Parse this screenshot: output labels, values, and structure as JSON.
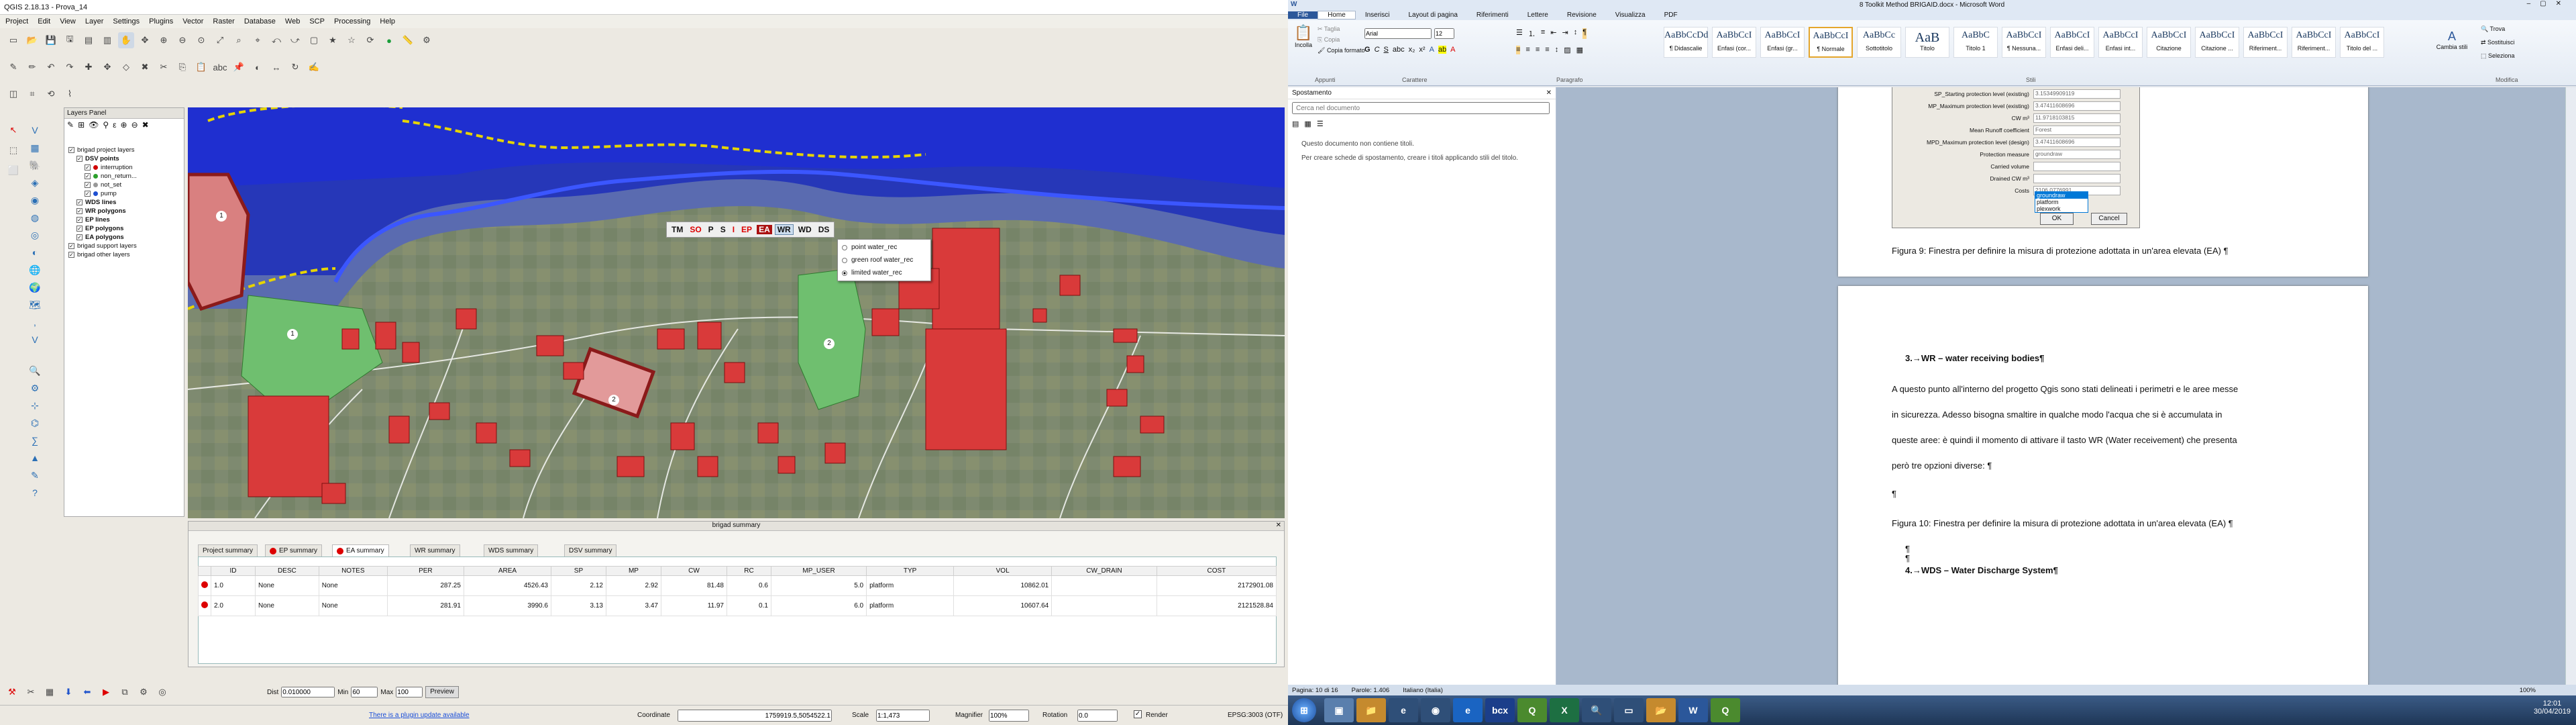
{
  "qgis": {
    "title": "QGIS 2.18.13 - Prova_14",
    "menu": [
      "Project",
      "Edit",
      "View",
      "Layer",
      "Settings",
      "Plugins",
      "Vector",
      "Raster",
      "Database",
      "Web",
      "SCP",
      "Processing",
      "Help"
    ],
    "layers_panel_title": "Layers Panel",
    "layers": [
      {
        "label": "brigad project layers",
        "indent": 0
      },
      {
        "label": "DSV points",
        "indent": 1,
        "bold": true
      },
      {
        "label": "interruption",
        "indent": 2,
        "color": "#d00000"
      },
      {
        "label": "non_return...",
        "indent": 2,
        "color": "#2ca02c"
      },
      {
        "label": "not_set",
        "indent": 2,
        "color": "#999999"
      },
      {
        "label": "pump",
        "indent": 2,
        "color": "#1f4fd1"
      },
      {
        "label": "WDS lines",
        "indent": 1,
        "bold": true
      },
      {
        "label": "WR polygons",
        "indent": 1,
        "bold": true
      },
      {
        "label": "EP lines",
        "indent": 1,
        "bold": true
      },
      {
        "label": "EP polygons",
        "indent": 1,
        "bold": true
      },
      {
        "label": "EA polygons",
        "indent": 1,
        "bold": true
      },
      {
        "label": "brigad support layers",
        "indent": 0
      },
      {
        "label": "brigad other layers",
        "indent": 0
      }
    ],
    "map_toolbar": [
      "TM",
      "SO",
      "P",
      "S",
      "I",
      "EP",
      "EA",
      "WR",
      "WD",
      "DS"
    ],
    "wr_menu": [
      "point water_rec",
      "green roof water_rec",
      "limited water_rec"
    ],
    "map_labels": [
      "1",
      "1",
      "2",
      "2"
    ],
    "bigado": {
      "title": "brigad summary",
      "tabs": [
        "Project summary",
        "EP summary",
        "EA summary",
        "WR summary",
        "WDS summary",
        "DSV summary"
      ],
      "columns": [
        "ID",
        "DESC",
        "NOTES",
        "PER",
        "AREA",
        "SP",
        "MP",
        "CW",
        "RC",
        "MP_USER",
        "TYP",
        "VOL",
        "CW_DRAIN",
        "COST"
      ],
      "rows": [
        [
          "1.0",
          "None",
          "None",
          "287.25",
          "4526.43",
          "2.12",
          "2.92",
          "81.48",
          "0.6",
          "5.0",
          "platform",
          "10862.01",
          "",
          "2172901.08"
        ],
        [
          "2.0",
          "None",
          "None",
          "281.91",
          "3990.6",
          "3.13",
          "3.47",
          "11.97",
          "0.1",
          "6.0",
          "platform",
          "10607.64",
          "",
          "2121528.84"
        ]
      ]
    },
    "status": {
      "update": "There is a plugin update available",
      "coord_label": "Coordinate",
      "coord": "1759919.5,5054522.1",
      "scale_label": "Scale",
      "scale": "1:1,473",
      "magnifier_label": "Magnifier",
      "magnifier": "100%",
      "rotation_label": "Rotation",
      "rotation": "0.0",
      "render": "Render",
      "crs": "EPSG:3003 (OTF)"
    },
    "toolbar_bottom": {
      "dist_label": "Dist",
      "dist": "0.010000",
      "min_label": "Min",
      "min": "60",
      "max_label": "Max",
      "max": "100",
      "preview": "Preview"
    }
  },
  "word": {
    "title": "8 Toolkit Method BRIGAID.docx - Microsoft Word",
    "tabs": [
      "File",
      "Home",
      "Inserisci",
      "Layout di pagina",
      "Riferimenti",
      "Lettere",
      "Revisione",
      "Visualizza",
      "PDF"
    ],
    "clipboard": {
      "paste": "Incolla",
      "cut": "Taglia",
      "copy": "Copia",
      "format": "Copia formato",
      "group": "Appunti"
    },
    "font": {
      "name": "Arial",
      "size": "12",
      "group": "Carattere"
    },
    "paragraph_group": "Paragrafo",
    "styles_group": "Stili",
    "edit_group": "Modifica",
    "styles": [
      {
        "preview": "AaBbCcDd",
        "label": "¶ Didascalie"
      },
      {
        "preview": "AaBbCcI",
        "label": "Enfasi (cor..."
      },
      {
        "preview": "AaBbCcI",
        "label": "Enfasi (gr..."
      },
      {
        "preview": "AaBbCcI",
        "label": "¶ Normale"
      },
      {
        "preview": "AaBbCc",
        "label": "Sottotitolo"
      },
      {
        "preview": "AaB",
        "label": "Titolo"
      },
      {
        "preview": "AaBbC",
        "label": "Titolo 1"
      },
      {
        "preview": "AaBbCcI",
        "label": "¶ Nessuna..."
      },
      {
        "preview": "AaBbCcI",
        "label": "Enfasi deli..."
      },
      {
        "preview": "AaBbCcI",
        "label": "Enfasi int..."
      },
      {
        "preview": "AaBbCcI",
        "label": "Citazione"
      },
      {
        "preview": "AaBbCcI",
        "label": "Citazione ..."
      },
      {
        "preview": "AaBbCcI",
        "label": "Riferiment..."
      },
      {
        "preview": "AaBbCcI",
        "label": "Riferiment..."
      },
      {
        "preview": "AaBbCcI",
        "label": "Titolo del ..."
      }
    ],
    "change_styles": "Cambia stili",
    "find": "Trova",
    "replace": "Sostituisci",
    "select": "Seleziona",
    "nav": {
      "title": "Spostamento",
      "search_placeholder": "Cerca nel documento",
      "msg1": "Questo documento non contiene titoli.",
      "msg2": "Per creare schede di spostamento, creare i titoli applicando stili del titolo."
    },
    "dialog": {
      "fields": [
        {
          "label": "SP_Starting protection level (existing)",
          "value": "3.15349909119"
        },
        {
          "label": "MP_Maximum protection level (existing)",
          "value": "3.47411608696"
        },
        {
          "label": "CW m³",
          "value": "11.9718103815"
        },
        {
          "label": "Mean Runoff coefficient",
          "value": "Forest"
        },
        {
          "label": "MPD_Maximum protection level (design)",
          "value": "3.47411608696"
        },
        {
          "label": "Protection measure",
          "value": "groundraw"
        },
        {
          "label": "Carried volume",
          "value": ""
        },
        {
          "label": "Drained CW m³",
          "value": ""
        },
        {
          "label": "Costs",
          "value": "2106.0776991"
        }
      ],
      "options": [
        "groundraw",
        "platform",
        "plexwork"
      ],
      "ok": "OK",
      "cancel": "Cancel"
    },
    "doc": {
      "fig9": "Figura 9: Finestra per definire la misura di protezione adottata in un'area elevata (EA) ¶",
      "h3": "3.→WR – water receiving bodies¶",
      "p1": "A questo punto all'interno del progetto Qgis sono stati delineati i perimetri e le aree messe",
      "p2": "in sicurezza. Adesso bisogna smaltire in qualche modo l'acqua che si è accumulata in",
      "p3": "queste aree: è quindi il momento di attivare il tasto WR (Water receivement) che presenta",
      "p4": "però tre opzioni diverse: ¶",
      "para": "¶",
      "fig10": "Figura 10: Finestra per definire la misura di protezione adottata in un'area elevata (EA) ¶",
      "h4": "4.→WDS – Water Discharge System¶"
    },
    "status": {
      "page": "Pagina: 10 di 16",
      "words": "Parole: 1.406",
      "lang": "Italiano (Italia)",
      "zoom": "100%"
    },
    "clock": {
      "time": "12:01",
      "date": "30/04/2019"
    }
  },
  "taskbar_apps": [
    "start",
    "explorer",
    "ie",
    "chrome",
    "edge",
    "bcx",
    "qgis",
    "excel",
    "search",
    "folder",
    "explorer2",
    "word",
    "qgis2"
  ],
  "colors": {
    "water": "#1f3fd6",
    "building": "#d93a3a",
    "green": "#6fbf6f",
    "ea": "#8b1a1a",
    "ribbon_blue": "#2b579a"
  }
}
